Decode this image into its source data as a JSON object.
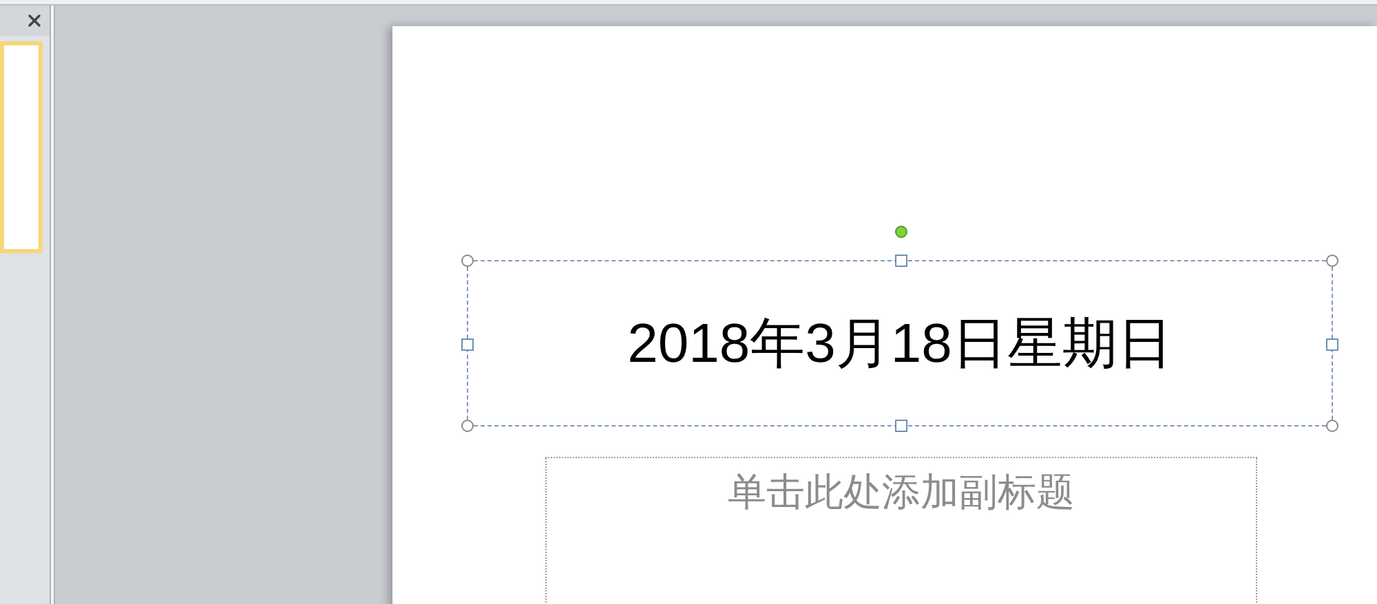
{
  "thumbnail_pane": {
    "slides": [
      {
        "selected": true
      }
    ]
  },
  "slide": {
    "title": {
      "text": "2018年3月18日星期日",
      "selected": true
    },
    "subtitle": {
      "prompt_text": "单击此处添加副标题",
      "selected": false
    }
  }
}
